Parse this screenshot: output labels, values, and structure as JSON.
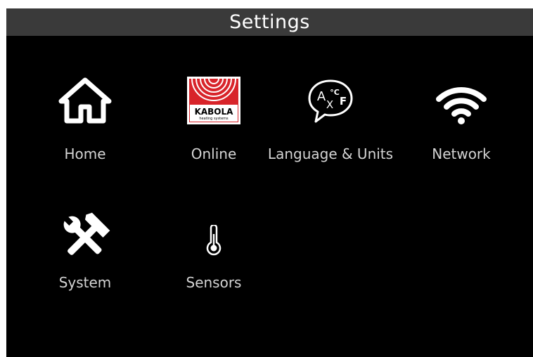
{
  "title": "Settings",
  "tiles": [
    {
      "label": "Home",
      "icon": "home-icon"
    },
    {
      "label": "Online",
      "icon": "kabola-logo-icon",
      "logo_text": "KABOLA",
      "logo_subtext": "heating systems"
    },
    {
      "label": "Language & Units",
      "icon": "language-units-icon",
      "glyph_a": "A",
      "glyph_x": "X",
      "glyph_c": "°C",
      "glyph_f": "F"
    },
    {
      "label": "Network",
      "icon": "wifi-icon"
    },
    {
      "label": "System",
      "icon": "tools-icon"
    },
    {
      "label": "Sensors",
      "icon": "thermometer-icon"
    }
  ],
  "colors": {
    "background": "#000000",
    "titlebar": "#3a3a3a",
    "title_text": "#ffffff",
    "label_text": "#d4d4d4",
    "kabola_red": "#d8242a"
  }
}
